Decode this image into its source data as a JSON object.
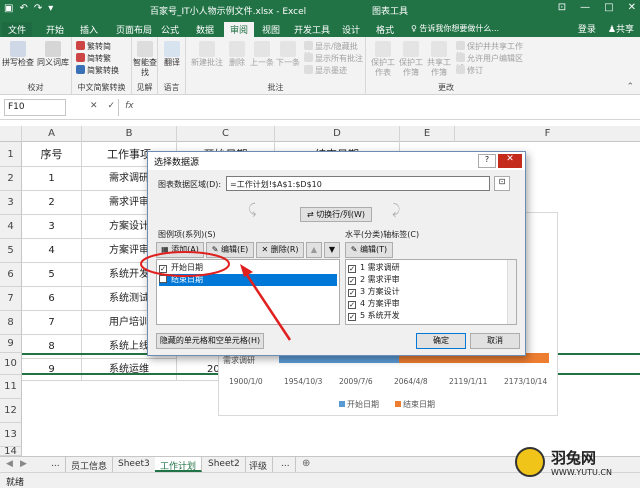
{
  "window": {
    "filename": "百家号_IT小人物示例文件.xlsx - Excel",
    "context_tab": "图表工具",
    "buttons": [
      "—",
      "□",
      "✕"
    ]
  },
  "tabs": [
    "文件",
    "开始",
    "插入",
    "页面布局",
    "公式",
    "数据",
    "审阅",
    "视图",
    "开发工具",
    "设计",
    "格式"
  ],
  "help": {
    "tell_me": "告诉我你想要做什么...",
    "login": "登录",
    "share": "共享"
  },
  "ribbon": {
    "proofing": {
      "label": "校对",
      "spell": "拼写检查",
      "thesaurus": "同义词库"
    },
    "chinese": {
      "label": "中文简繁转换",
      "to_trad": "繁转简",
      "to_simp": "简转繁",
      "convert": "简繁转换"
    },
    "insights": {
      "label": "见解",
      "smart_lookup": "智能查找"
    },
    "language": {
      "label": "语言",
      "translate": "翻译"
    },
    "comments": {
      "label": "批注",
      "new": "新建批注",
      "delete": "删除",
      "prev": "上一条",
      "next": "下一条",
      "show_hide": "显示/隐藏批注",
      "show_all": "显示所有批注",
      "show_ink": "显示墨迹"
    },
    "changes": {
      "label": "更改",
      "protect_sheet": "保护工作表",
      "protect_wb": "保护工作簿",
      "share_wb": "共享工作簿",
      "protect_share": "保护并共享工作簿",
      "allow_edit": "允许用户编辑区域",
      "track": "修订"
    }
  },
  "formula": {
    "namebox": "F10",
    "fx": "fx"
  },
  "columns": [
    "A",
    "B",
    "C",
    "D",
    "E",
    "F"
  ],
  "headers": {
    "a": "序号",
    "b": "工作事项",
    "c": "开始日期",
    "d": "结束日期"
  },
  "rows": [
    {
      "n": "1",
      "b": "需求调研"
    },
    {
      "n": "2",
      "b": "需求评审"
    },
    {
      "n": "3",
      "b": "方案设计"
    },
    {
      "n": "4",
      "b": "方案评审"
    },
    {
      "n": "5",
      "b": "系统开发"
    },
    {
      "n": "6",
      "b": "系统测试"
    },
    {
      "n": "7",
      "b": "用户培训"
    },
    {
      "n": "8",
      "b": "系统上线"
    },
    {
      "n": "9",
      "b": "系统运维",
      "c": "20"
    }
  ],
  "rownums": [
    "1",
    "2",
    "3",
    "4",
    "5",
    "6",
    "7",
    "8",
    "9",
    "10",
    "11",
    "12",
    "13",
    "14"
  ],
  "chart_data": {
    "type": "bar",
    "categories": [
      "需求调研"
    ],
    "x_ticks": [
      "1900/1/0",
      "1954/10/3",
      "2009/7/6",
      "2064/4/8",
      "2119/1/11",
      "2173/10/14"
    ],
    "series": [
      {
        "name": "开始日期",
        "color": "#5b9bd5"
      },
      {
        "name": "结束日期",
        "color": "#ed7d31"
      }
    ],
    "legend": "bottom"
  },
  "dialog": {
    "title": "选择数据源",
    "range_label": "图表数据区域(D):",
    "range_value": "=工作计划!$A$1:$D$10",
    "switch": "切换行/列(W)",
    "series_label": "图例项(系列)(S)",
    "add": "添加(A)",
    "edit": "编辑(E)",
    "remove": "删除(R)",
    "series": [
      {
        "label": "开始日期",
        "checked": true
      },
      {
        "label": "结束日期",
        "checked": false
      }
    ],
    "axis_label": "水平(分类)轴标签(C)",
    "axis_edit": "编辑(T)",
    "axis_items": [
      "1 需求调研",
      "2 需求评审",
      "3 方案设计",
      "4 方案评审",
      "5 系统开发"
    ],
    "hidden_btn": "隐藏的单元格和空单元格(H)",
    "ok": "确定",
    "cancel": "取消",
    "help": "?",
    "close": "✕"
  },
  "sheets": [
    "...",
    "员工信息",
    "Sheet3",
    "工作计划",
    "Sheet2",
    "评级",
    "..."
  ],
  "status": {
    "ready": "就绪"
  },
  "watermark": {
    "text": "羽兔网",
    "url": "WWW.YUTU.CN"
  }
}
